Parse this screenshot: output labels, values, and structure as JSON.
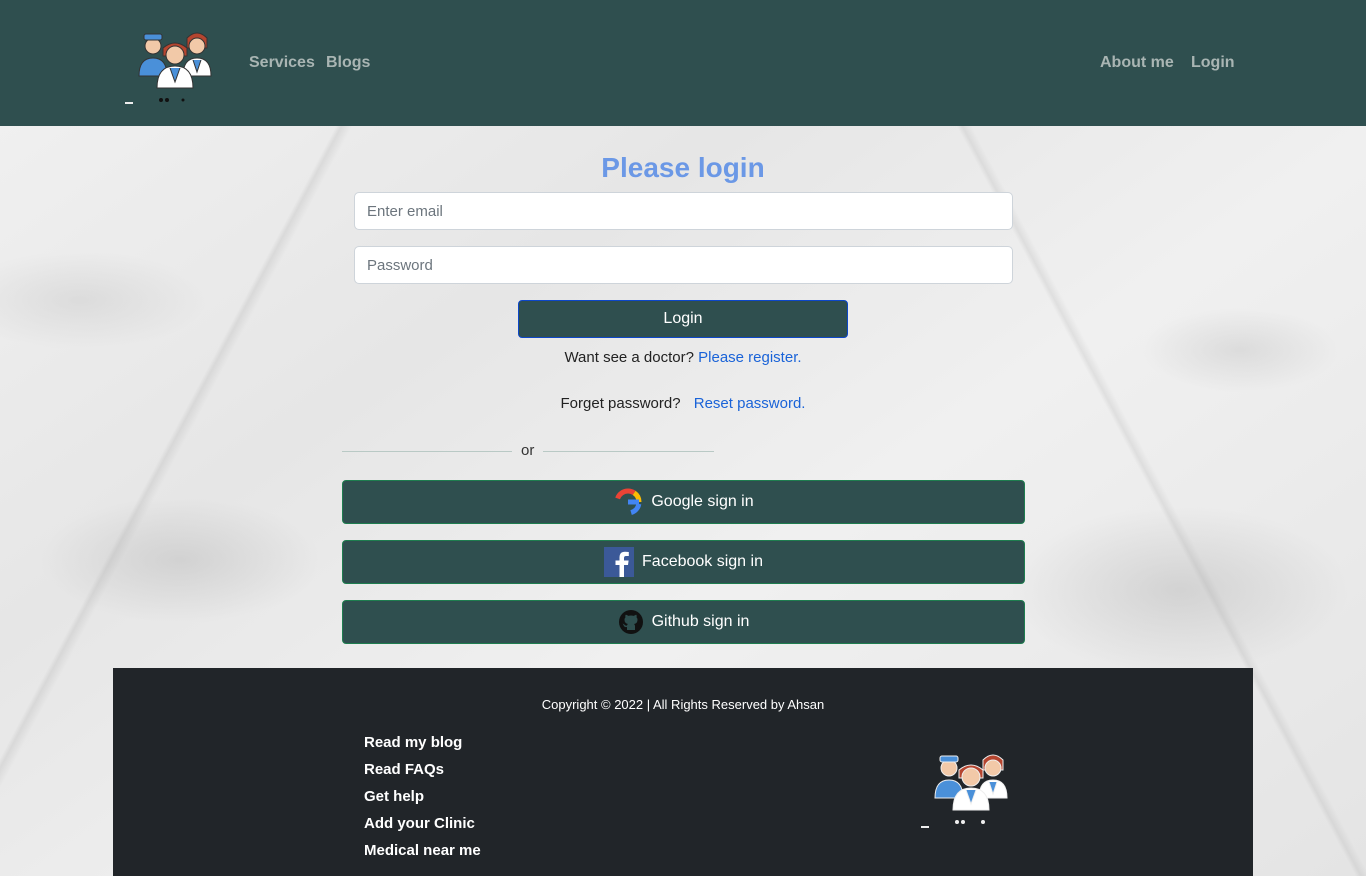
{
  "nav": {
    "links_left": [
      "Services",
      "Blogs"
    ],
    "links_right": [
      "About me",
      "Login"
    ]
  },
  "login": {
    "title": "Please login",
    "email_placeholder": "Enter email",
    "password_placeholder": "Password",
    "submit_label": "Login",
    "register_prompt": "Want see a doctor?",
    "register_link": "Please register.",
    "forgot_prompt": "Forget password?",
    "reset_link": "Reset password.",
    "or_label": "or"
  },
  "social": {
    "google_label": "Google sign in",
    "facebook_label": "Facebook sign in",
    "github_label": "Github sign in"
  },
  "footer": {
    "copyright": "Copyright © 2022 | All Rights Reserved by Ahsan",
    "links": [
      "Read my blog",
      "Read FAQs",
      "Get help",
      "Add your Clinic",
      "Medical near me"
    ]
  },
  "colors": {
    "nav_bg": "#2f4f4f",
    "title": "#6b98e6",
    "link": "#1a63d8",
    "footer_bg": "#212529"
  },
  "icons": [
    "doctors-logo-icon",
    "google-icon",
    "facebook-icon",
    "github-icon"
  ]
}
